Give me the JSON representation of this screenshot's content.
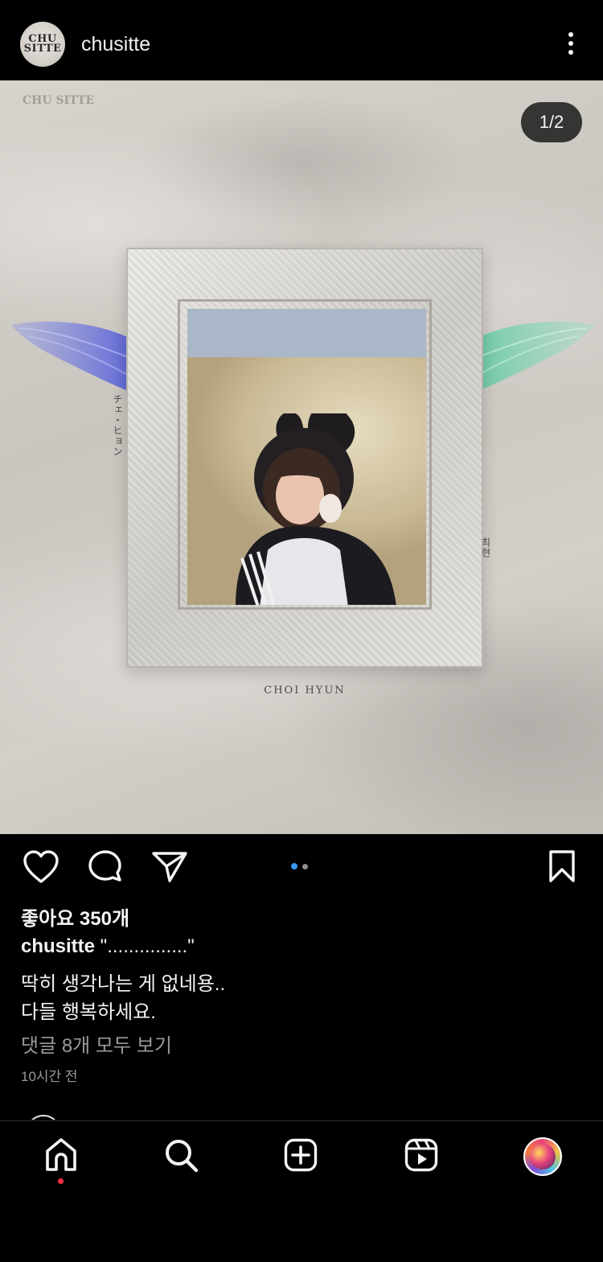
{
  "header": {
    "avatar_logo": "CHU SITTE",
    "username": "chusitte",
    "more_icon": "more-vertical-icon"
  },
  "post": {
    "image_counter": "1/2",
    "watermark_logo": "CHU SITTE",
    "artwork": {
      "vertical_text_left": "チェ・ヒョン",
      "vertical_text_right": "최현",
      "caption": "CHOI HYUN"
    },
    "carousel": {
      "count": 2,
      "active_index": 0,
      "active_color": "#3897f0",
      "inactive_color": "#8e8e8e"
    }
  },
  "actions": {
    "like_icon": "heart-icon",
    "comment_icon": "comment-bubble-icon",
    "share_icon": "paper-plane-icon",
    "save_icon": "bookmark-icon"
  },
  "details": {
    "likes": "좋아요 350개",
    "caption_user": "chusitte",
    "caption_text": " \"...............\"",
    "caption_line2": "딱히 생각나는 게 없네용..",
    "caption_line3": "다들 행복하세요.",
    "view_comments": "댓글 8개 모두 보기",
    "timestamp": "10시간 전"
  },
  "tabbar": {
    "items": [
      "home-icon",
      "search-icon",
      "create-plus-icon",
      "reels-icon",
      "profile-avatar"
    ],
    "notification_color": "#ff3040"
  }
}
